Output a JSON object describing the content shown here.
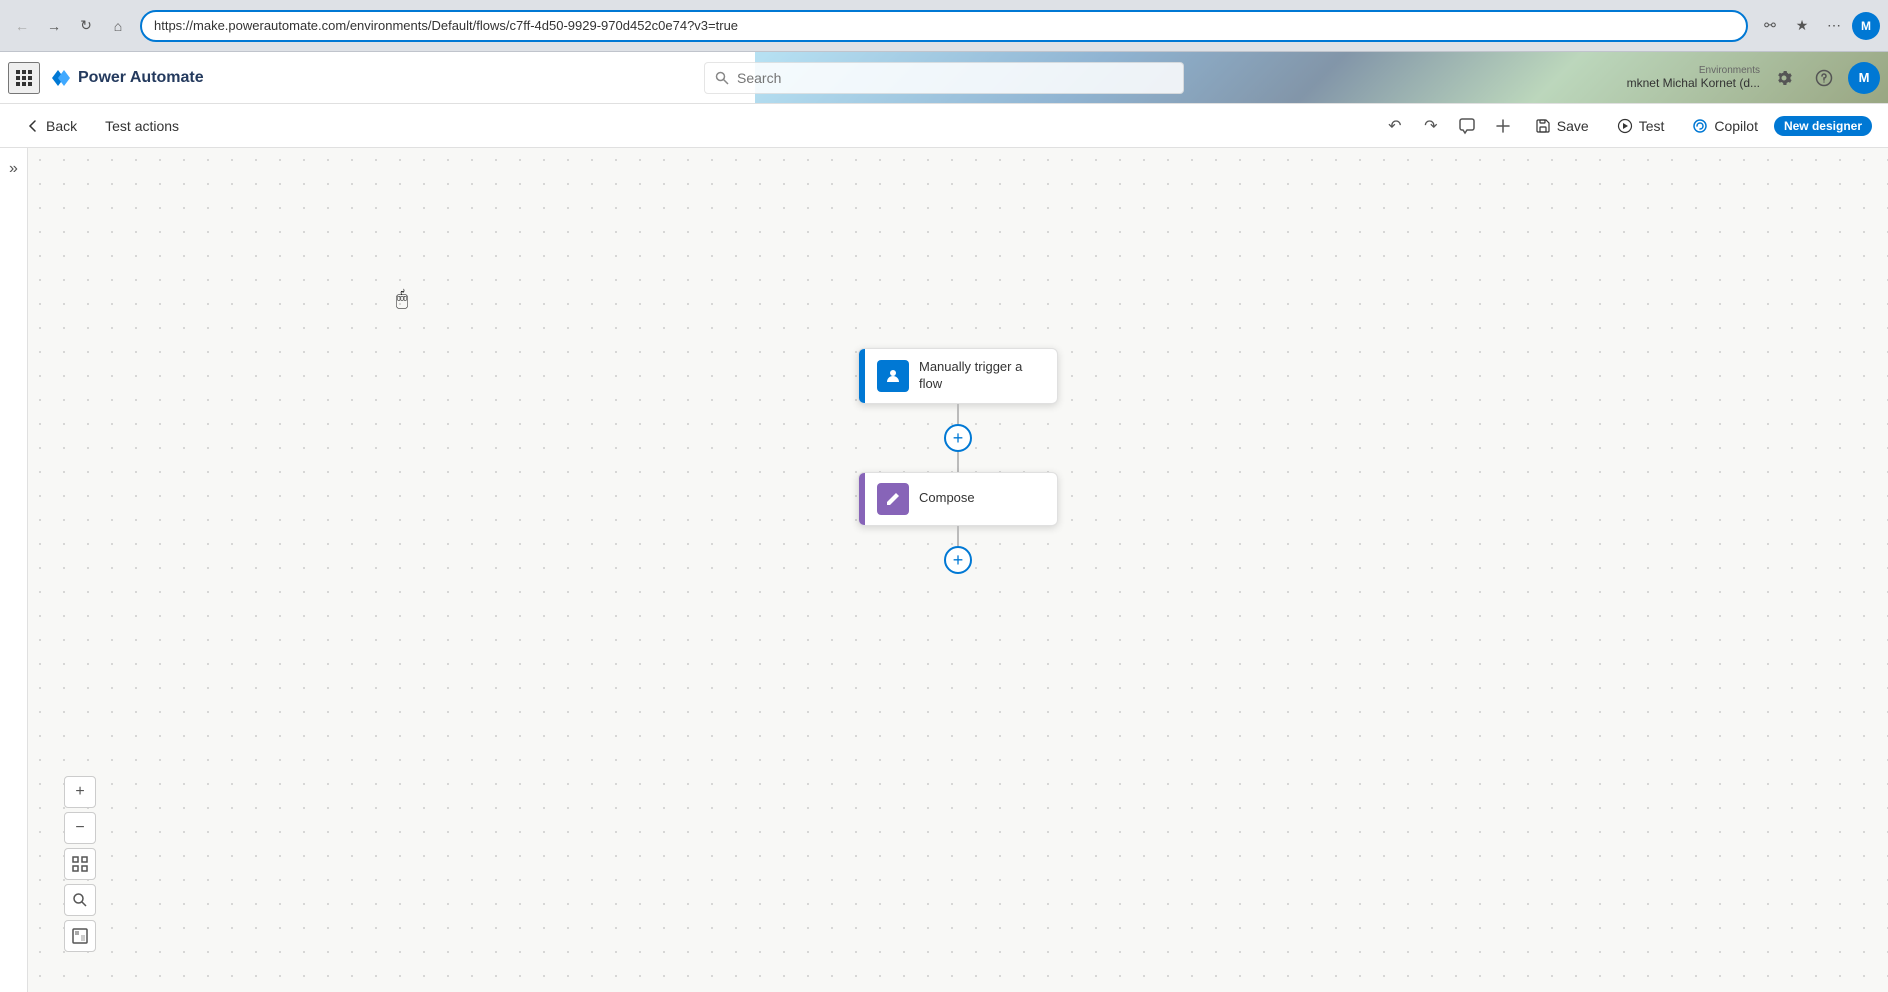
{
  "browser": {
    "url": "https://make.powerautomate.com/environments/Default/flows/c7ff-4d50-9929-970d452c0e74?v3=true",
    "nav": {
      "back_label": "←",
      "forward_label": "→",
      "refresh_label": "↻",
      "home_label": "⌂"
    },
    "profile_initial": "M"
  },
  "header": {
    "app_name": "Power Automate",
    "search_placeholder": "Search",
    "environment_label": "Environments",
    "environment_name": "mknet Michal Kornet (d...",
    "settings_label": "Settings",
    "help_label": "Help",
    "user_initial": "M"
  },
  "toolbar": {
    "back_label": "Back",
    "test_actions_label": "Test actions",
    "undo_label": "⟲",
    "redo_label": "⟳",
    "comment_label": "💬",
    "variable_label": "⚡",
    "save_label": "Save",
    "test_label": "Test",
    "copilot_label": "Copilot",
    "new_designer_label": "New designer"
  },
  "canvas": {
    "sidebar_toggle": "»"
  },
  "flow": {
    "trigger_node": {
      "label": "Manually trigger a flow",
      "icon": "👤",
      "accent": "blue"
    },
    "compose_node": {
      "label": "Compose",
      "icon": "⚡",
      "accent": "purple"
    }
  },
  "zoom": {
    "zoom_in_label": "+",
    "zoom_out_label": "−",
    "fit_label": "⊡",
    "search_label": "🔍",
    "map_label": "⊞"
  }
}
